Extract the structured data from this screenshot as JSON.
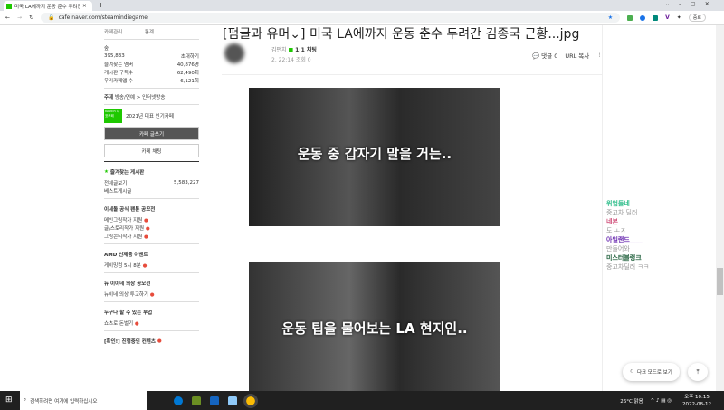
{
  "browser": {
    "tab_title": "미국 LA에까지 운동 춘수 두려간",
    "url": "cafe.naver.com/steamindiegame",
    "profile_label": "중료"
  },
  "sidebar": {
    "manage": "카페관리",
    "stats": "통계",
    "level": "숲",
    "members": "395,833",
    "invite": "초대하기",
    "stats_rows": [
      {
        "label": "즐겨찾는 멤버",
        "value": "40,876명"
      },
      {
        "label": "게시판 구독수",
        "value": "62,490회"
      },
      {
        "label": "우리카페앱 수",
        "value": "6,121회"
      }
    ],
    "topic_label": "주제",
    "topic": "방송/연예 > 인터넷방송",
    "badge": "NAVER 대표카페",
    "badge_text": "2021년 대표 인기카페",
    "write_btn": "카페 글쓰기",
    "chat_btn": "카페 채팅",
    "fav_header": "즐겨찾는 게시판",
    "sections": [
      {
        "header": "",
        "items": [
          {
            "label": "전체글보기",
            "count": "5,583,227"
          },
          {
            "label": "베스트게시글"
          }
        ]
      },
      {
        "header": "이세돌 공식 팬툰 공모전",
        "items": [
          {
            "label": "메인그림작가 지원"
          },
          {
            "label": "글/스토리작가 지원"
          },
          {
            "label": "그림콘티작가 지원"
          }
        ]
      },
      {
        "header": "AMD 신제품 이벤트",
        "items": [
          {
            "label": "게이밍컴 5시 8분"
          }
        ]
      },
      {
        "header": "뉴 이이네 의상 공모전",
        "items": [
          {
            "label": "뉴이네 의상 투고하기"
          }
        ]
      },
      {
        "header": "누구나 할 수 있는 부업",
        "items": [
          {
            "label": "쇼츠로 돈벌기"
          }
        ]
      },
      {
        "header": "[확인!] 진행중인 컨텐츠",
        "items": []
      }
    ]
  },
  "post": {
    "title": "[펌글과 유머⌄] 미국 LA에까지 운동 춘수 두려간 김종국 근황...jpg",
    "author_suffix": "김펀치",
    "chat": "1:1 채팅",
    "date": "2. 22:14",
    "views": "조회 0",
    "comments": "댓글 0",
    "url_copy": "URL 복사",
    "captions": [
      "운동 중 갑자기 말을 거는..",
      "운동 팁을 물어보는 LA 현지인.."
    ]
  },
  "recommend": [
    {
      "name": "워엄들네",
      "sub": "중고차 딜러",
      "color": "#2ebd8a"
    },
    {
      "name": "네본",
      "sub": "도 ㅗㅈ",
      "color": "#d0507a"
    },
    {
      "name": "아일랜드____",
      "sub": "만들어와",
      "color": "#6a2bb0"
    },
    {
      "name": "미스터블랭크",
      "sub": "중고차딜러 ㅋㅋ",
      "color": "#1e5e3a"
    }
  ],
  "dark_mode": "다크 모드로 보기",
  "taskbar": {
    "search": "검색하려면 여기에 입력하십시오",
    "weather": "26°C 맑음",
    "time": "오후 10:15",
    "date": "2022-08-12"
  }
}
